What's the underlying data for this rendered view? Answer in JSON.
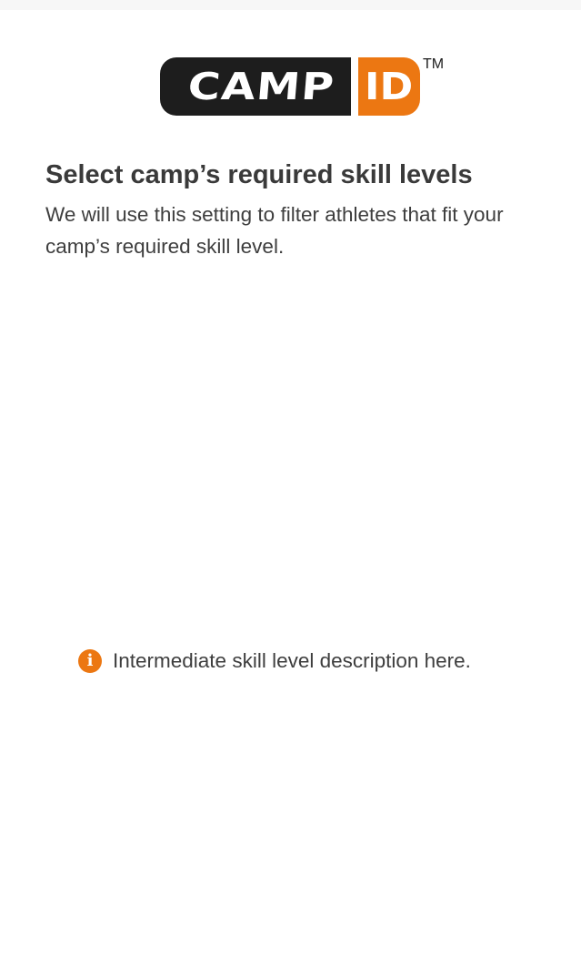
{
  "logo": {
    "word_left": "CAMP",
    "word_right": "ID",
    "trademark": "TM",
    "colors": {
      "dark": "#1d1d1d",
      "accent": "#ec7712"
    }
  },
  "header": {
    "title": "Select camp’s required skill levels",
    "subtitle": "We will use this setting to filter athletes that fit your camp’s required skill level."
  },
  "info": {
    "icon": "info-icon",
    "glyph": "i",
    "text": "Intermediate skill level description here.",
    "color": "#ec7712"
  }
}
